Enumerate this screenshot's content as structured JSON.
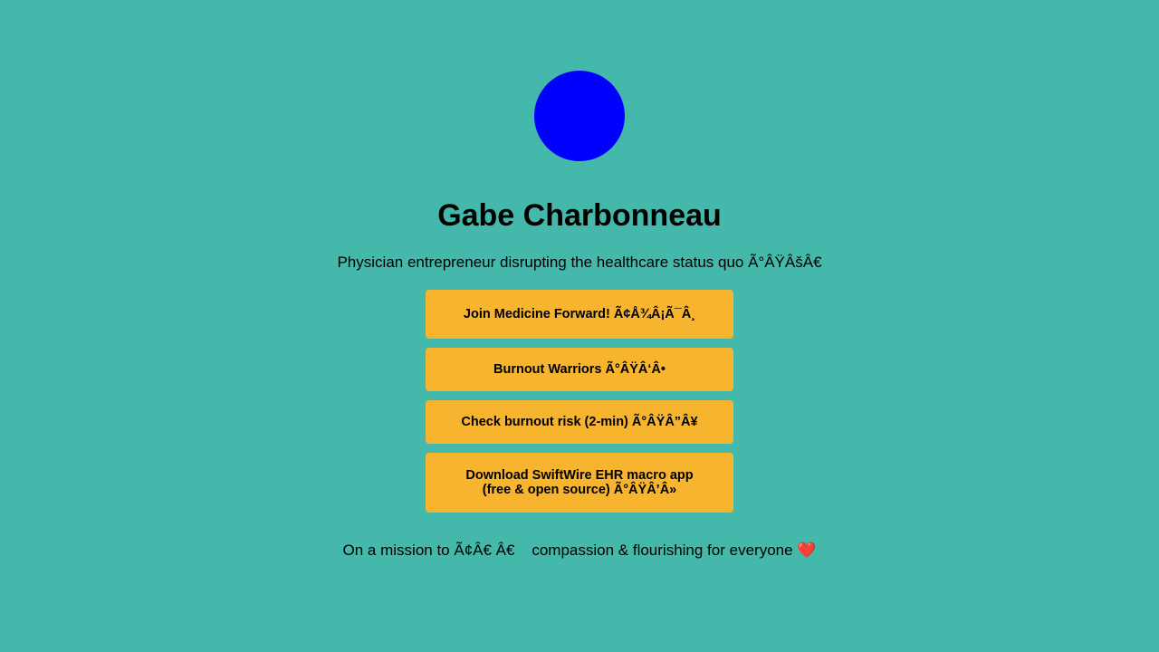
{
  "profile": {
    "avatar_color": "#0000ff",
    "name": "Gabe Charbonneau",
    "bio": "Physician entrepreneur disrupting the healthcare status quo Ã°ÂŸÂšÂ€"
  },
  "links": [
    {
      "label": "Join Medicine Forward! Ã¢Å¾Â¡Ã¯Â¸"
    },
    {
      "label": "Burnout Warriors Ã°ÂŸÂ‘Â•"
    },
    {
      "label": "Check burnout risk (2-min) Ã°ÂŸÂ”Â¥"
    },
    {
      "label": "Download SwiftWire EHR macro app (free & open source) Ã°ÂŸÂ’Â»"
    }
  ],
  "footer": {
    "text": "On a mission to Ã¢Â€ Â€    compassion & flourishing for everyone ",
    "heart": "❤️"
  },
  "colors": {
    "background": "#45b8ac",
    "button": "#f6b42f",
    "avatar": "#0000ff"
  }
}
